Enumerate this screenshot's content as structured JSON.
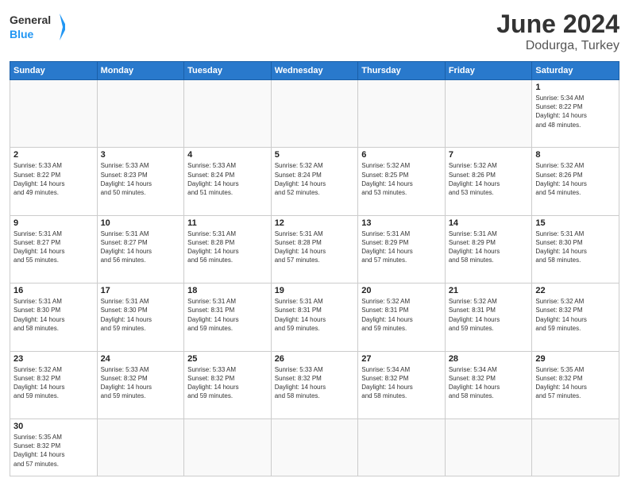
{
  "header": {
    "logo_general": "General",
    "logo_blue": "Blue",
    "month_year": "June 2024",
    "location": "Dodurga, Turkey"
  },
  "weekdays": [
    "Sunday",
    "Monday",
    "Tuesday",
    "Wednesday",
    "Thursday",
    "Friday",
    "Saturday"
  ],
  "days": [
    {
      "num": "",
      "info": ""
    },
    {
      "num": "",
      "info": ""
    },
    {
      "num": "",
      "info": ""
    },
    {
      "num": "",
      "info": ""
    },
    {
      "num": "",
      "info": ""
    },
    {
      "num": "",
      "info": ""
    },
    {
      "num": "1",
      "info": "Sunrise: 5:34 AM\nSunset: 8:22 PM\nDaylight: 14 hours\nand 48 minutes."
    },
    {
      "num": "2",
      "info": "Sunrise: 5:33 AM\nSunset: 8:22 PM\nDaylight: 14 hours\nand 49 minutes."
    },
    {
      "num": "3",
      "info": "Sunrise: 5:33 AM\nSunset: 8:23 PM\nDaylight: 14 hours\nand 50 minutes."
    },
    {
      "num": "4",
      "info": "Sunrise: 5:33 AM\nSunset: 8:24 PM\nDaylight: 14 hours\nand 51 minutes."
    },
    {
      "num": "5",
      "info": "Sunrise: 5:32 AM\nSunset: 8:24 PM\nDaylight: 14 hours\nand 52 minutes."
    },
    {
      "num": "6",
      "info": "Sunrise: 5:32 AM\nSunset: 8:25 PM\nDaylight: 14 hours\nand 53 minutes."
    },
    {
      "num": "7",
      "info": "Sunrise: 5:32 AM\nSunset: 8:26 PM\nDaylight: 14 hours\nand 53 minutes."
    },
    {
      "num": "8",
      "info": "Sunrise: 5:32 AM\nSunset: 8:26 PM\nDaylight: 14 hours\nand 54 minutes."
    },
    {
      "num": "9",
      "info": "Sunrise: 5:31 AM\nSunset: 8:27 PM\nDaylight: 14 hours\nand 55 minutes."
    },
    {
      "num": "10",
      "info": "Sunrise: 5:31 AM\nSunset: 8:27 PM\nDaylight: 14 hours\nand 56 minutes."
    },
    {
      "num": "11",
      "info": "Sunrise: 5:31 AM\nSunset: 8:28 PM\nDaylight: 14 hours\nand 56 minutes."
    },
    {
      "num": "12",
      "info": "Sunrise: 5:31 AM\nSunset: 8:28 PM\nDaylight: 14 hours\nand 57 minutes."
    },
    {
      "num": "13",
      "info": "Sunrise: 5:31 AM\nSunset: 8:29 PM\nDaylight: 14 hours\nand 57 minutes."
    },
    {
      "num": "14",
      "info": "Sunrise: 5:31 AM\nSunset: 8:29 PM\nDaylight: 14 hours\nand 58 minutes."
    },
    {
      "num": "15",
      "info": "Sunrise: 5:31 AM\nSunset: 8:30 PM\nDaylight: 14 hours\nand 58 minutes."
    },
    {
      "num": "16",
      "info": "Sunrise: 5:31 AM\nSunset: 8:30 PM\nDaylight: 14 hours\nand 58 minutes."
    },
    {
      "num": "17",
      "info": "Sunrise: 5:31 AM\nSunset: 8:30 PM\nDaylight: 14 hours\nand 59 minutes."
    },
    {
      "num": "18",
      "info": "Sunrise: 5:31 AM\nSunset: 8:31 PM\nDaylight: 14 hours\nand 59 minutes."
    },
    {
      "num": "19",
      "info": "Sunrise: 5:31 AM\nSunset: 8:31 PM\nDaylight: 14 hours\nand 59 minutes."
    },
    {
      "num": "20",
      "info": "Sunrise: 5:32 AM\nSunset: 8:31 PM\nDaylight: 14 hours\nand 59 minutes."
    },
    {
      "num": "21",
      "info": "Sunrise: 5:32 AM\nSunset: 8:31 PM\nDaylight: 14 hours\nand 59 minutes."
    },
    {
      "num": "22",
      "info": "Sunrise: 5:32 AM\nSunset: 8:32 PM\nDaylight: 14 hours\nand 59 minutes."
    },
    {
      "num": "23",
      "info": "Sunrise: 5:32 AM\nSunset: 8:32 PM\nDaylight: 14 hours\nand 59 minutes."
    },
    {
      "num": "24",
      "info": "Sunrise: 5:33 AM\nSunset: 8:32 PM\nDaylight: 14 hours\nand 59 minutes."
    },
    {
      "num": "25",
      "info": "Sunrise: 5:33 AM\nSunset: 8:32 PM\nDaylight: 14 hours\nand 59 minutes."
    },
    {
      "num": "26",
      "info": "Sunrise: 5:33 AM\nSunset: 8:32 PM\nDaylight: 14 hours\nand 58 minutes."
    },
    {
      "num": "27",
      "info": "Sunrise: 5:34 AM\nSunset: 8:32 PM\nDaylight: 14 hours\nand 58 minutes."
    },
    {
      "num": "28",
      "info": "Sunrise: 5:34 AM\nSunset: 8:32 PM\nDaylight: 14 hours\nand 58 minutes."
    },
    {
      "num": "29",
      "info": "Sunrise: 5:35 AM\nSunset: 8:32 PM\nDaylight: 14 hours\nand 57 minutes."
    },
    {
      "num": "30",
      "info": "Sunrise: 5:35 AM\nSunset: 8:32 PM\nDaylight: 14 hours\nand 57 minutes."
    },
    {
      "num": "",
      "info": ""
    },
    {
      "num": "",
      "info": ""
    },
    {
      "num": "",
      "info": ""
    },
    {
      "num": "",
      "info": ""
    },
    {
      "num": "",
      "info": ""
    },
    {
      "num": "",
      "info": ""
    }
  ]
}
